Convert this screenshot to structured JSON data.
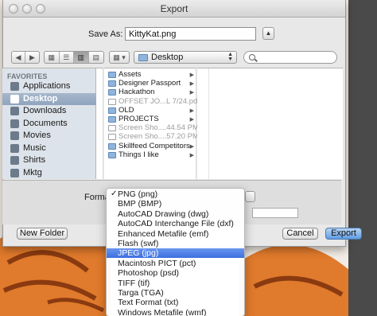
{
  "window": {
    "title": "Export"
  },
  "save_as": {
    "label": "Save As:",
    "value": "KittyKat.png",
    "expand_glyph": "▲"
  },
  "toolbar": {
    "nav_back_glyph": "◀",
    "nav_forward_glyph": "▶",
    "view_glyphs": [
      "▦",
      "☰",
      "▥",
      "▤"
    ],
    "arrange_glyph": "▦ ▾",
    "location": "Desktop",
    "location_arrows": "▲\n▼"
  },
  "sidebar": {
    "header": "FAVORITES",
    "items": [
      {
        "label": "Applications",
        "icon": "applications-icon",
        "selected": false
      },
      {
        "label": "Desktop",
        "icon": "desktop-icon",
        "selected": true
      },
      {
        "label": "Downloads",
        "icon": "downloads-icon",
        "selected": false
      },
      {
        "label": "Documents",
        "icon": "documents-icon",
        "selected": false
      },
      {
        "label": "Movies",
        "icon": "movies-icon",
        "selected": false
      },
      {
        "label": "Music",
        "icon": "music-icon",
        "selected": false
      },
      {
        "label": "Shirts",
        "icon": "folder-icon",
        "selected": false
      },
      {
        "label": "Mktg",
        "icon": "folder-icon",
        "selected": false
      }
    ]
  },
  "files": [
    {
      "name": "Assets",
      "kind": "folder",
      "dim": false,
      "expandable": true
    },
    {
      "name": "Designer Passport",
      "kind": "folder",
      "dim": false,
      "expandable": true
    },
    {
      "name": "Hackathon",
      "kind": "folder",
      "dim": false,
      "expandable": true
    },
    {
      "name": "OFFSET JO...L 7/24.pdf",
      "kind": "doc",
      "dim": true,
      "expandable": false
    },
    {
      "name": "OLD",
      "kind": "folder",
      "dim": false,
      "expandable": true
    },
    {
      "name": "PROJECTS",
      "kind": "folder",
      "dim": false,
      "expandable": true
    },
    {
      "name": "Screen Sho....44.54 PM",
      "kind": "doc",
      "dim": true,
      "expandable": false
    },
    {
      "name": "Screen Sho....57.20 PM",
      "kind": "doc",
      "dim": true,
      "expandable": false
    },
    {
      "name": "Skillfeed Competitors",
      "kind": "folder",
      "dim": false,
      "expandable": true
    },
    {
      "name": "Things I like",
      "kind": "folder",
      "dim": false,
      "expandable": true
    }
  ],
  "format": {
    "label": "Format",
    "options": [
      {
        "label": "PNG (png)",
        "checked": true,
        "highlighted": false
      },
      {
        "label": "BMP (BMP)",
        "checked": false,
        "highlighted": false
      },
      {
        "label": "AutoCAD Drawing (dwg)",
        "checked": false,
        "highlighted": false
      },
      {
        "label": "AutoCAD Interchange File (dxf)",
        "checked": false,
        "highlighted": false
      },
      {
        "label": "Enhanced Metafile (emf)",
        "checked": false,
        "highlighted": false
      },
      {
        "label": "Flash (swf)",
        "checked": false,
        "highlighted": false
      },
      {
        "label": "JPEG (jpg)",
        "checked": false,
        "highlighted": true
      },
      {
        "label": "Macintosh PICT (pct)",
        "checked": false,
        "highlighted": false
      },
      {
        "label": "Photoshop (psd)",
        "checked": false,
        "highlighted": false
      },
      {
        "label": "TIFF (tif)",
        "checked": false,
        "highlighted": false
      },
      {
        "label": "Targa (TGA)",
        "checked": false,
        "highlighted": false
      },
      {
        "label": "Text Format (txt)",
        "checked": false,
        "highlighted": false
      },
      {
        "label": "Windows Metafile (wmf)",
        "checked": false,
        "highlighted": false
      }
    ],
    "check_glyph": "✓"
  },
  "buttons": {
    "new_folder": "New Folder",
    "cancel": "Cancel",
    "export": "Export"
  },
  "colors": {
    "accent": "#3c6fe0",
    "sidebar_bg": "#dde3ea",
    "cat_orange": "#e07a2c"
  }
}
